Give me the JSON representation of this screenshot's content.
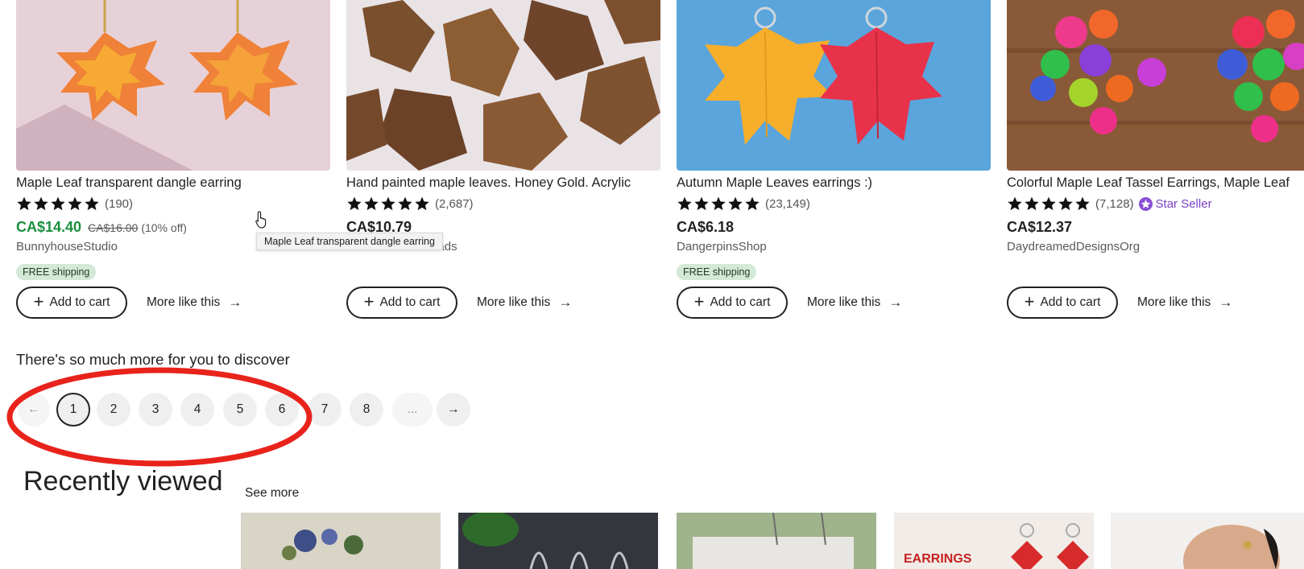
{
  "products": [
    {
      "title": "Maple Leaf transparent dangle earring",
      "reviews": "(190)",
      "rating": 5,
      "price": "CA$14.40",
      "original_price": "CA$16.00",
      "discount": "(10% off)",
      "shop": "BunnyhouseStudio",
      "shipping": "FREE shipping",
      "add_label": "Add to cart",
      "more_label": "More like this"
    },
    {
      "title": "Hand painted maple leaves. Honey Gold. Acrylic",
      "reviews": "(2,687)",
      "rating": 5,
      "price": "CA$10.79",
      "shop": "ColleenTolandBeads",
      "add_label": "Add to cart",
      "more_label": "More like this"
    },
    {
      "title": "Autumn Maple Leaves earrings :)",
      "reviews": "(23,149)",
      "rating": 5,
      "price": "CA$6.18",
      "shop": "DangerpinsShop",
      "shipping": "FREE shipping",
      "add_label": "Add to cart",
      "more_label": "More like this"
    },
    {
      "title": "Colorful Maple Leaf Tassel Earrings, Maple Leaf",
      "reviews": "(7,128)",
      "rating": 5,
      "star_seller": "Star Seller",
      "price": "CA$12.37",
      "shop": "DaydreamedDesignsOrg",
      "add_label": "Add to cart",
      "more_label": "More like this"
    }
  ],
  "tooltip": "Maple Leaf transparent dangle earring",
  "discover_heading": "There's so much more for you to discover",
  "pagination": {
    "prev_icon": "arrow-left-icon",
    "pages": [
      "1",
      "2",
      "3",
      "4",
      "5",
      "6",
      "7",
      "8"
    ],
    "current": "1",
    "ellipsis": "...",
    "next_icon": "arrow-right-icon"
  },
  "recently_viewed": {
    "title": "Recently viewed",
    "see_more": "See more",
    "thumb_overlay_text": "EARRINGS"
  },
  "colors": {
    "sale_price": "#1a8f3e",
    "free_shipping_bg": "#d4e9d7",
    "star_seller": "#7a42c4",
    "annotation_ring": "#e8231b"
  }
}
